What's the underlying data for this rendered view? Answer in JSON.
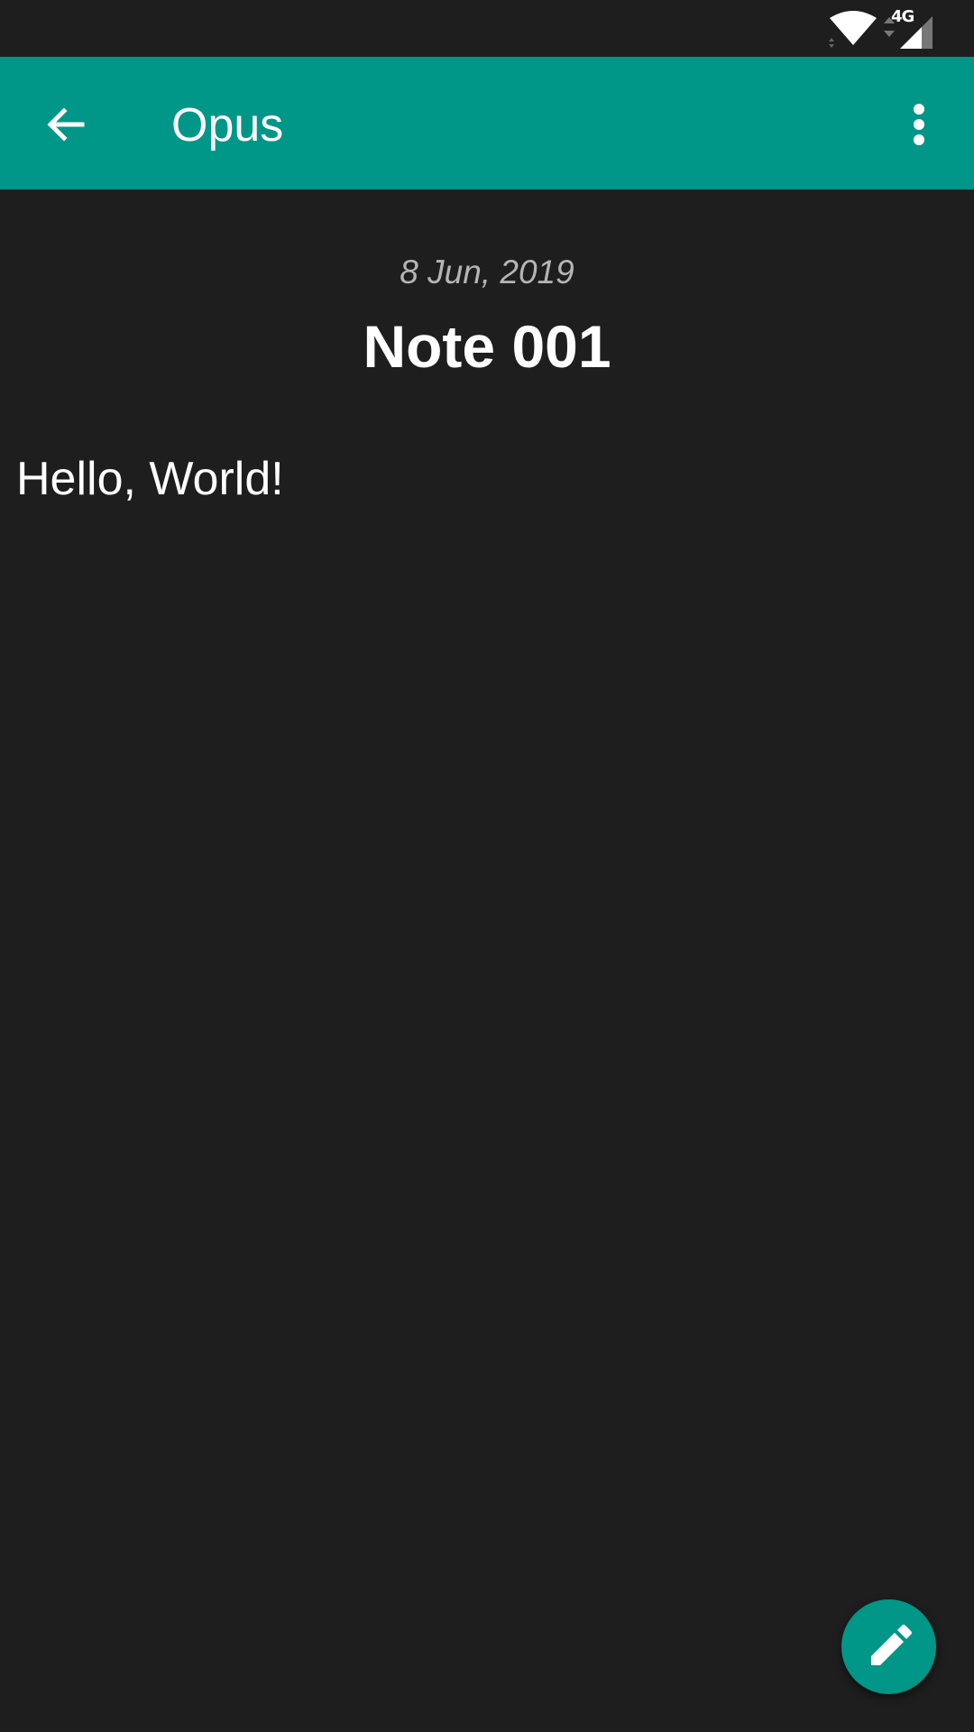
{
  "status_bar": {
    "network_label": "4G",
    "icons": [
      "wifi-icon",
      "signal-icon"
    ]
  },
  "toolbar": {
    "title": "Opus",
    "back_icon": "arrow-back-icon",
    "menu_icon": "more-vert-icon",
    "color": "#009688"
  },
  "note": {
    "date": "8 Jun, 2019",
    "title": "Note 001",
    "body": "Hello, World!"
  },
  "fab": {
    "icon": "edit-pencil-icon",
    "color": "#009688"
  },
  "theme": {
    "background": "#1e1e1e",
    "text": "#ffffff",
    "muted_text": "#b5b5b5"
  }
}
